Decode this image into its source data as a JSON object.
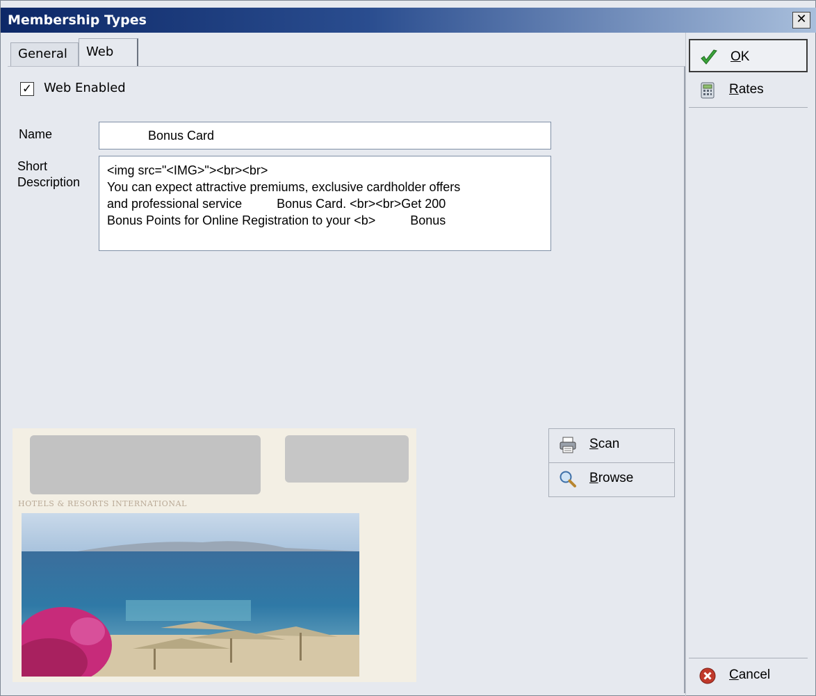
{
  "window": {
    "title": "Membership Types",
    "close_glyph": "✕"
  },
  "tabs": [
    {
      "label": "General",
      "active": false
    },
    {
      "label": "Web",
      "active": true
    }
  ],
  "web": {
    "web_enabled_label": "Web Enabled",
    "web_enabled_checked": true,
    "check_glyph": "✓",
    "name_label": "Name",
    "name_value": "Bonus Card",
    "short_description_label": "Short Description",
    "short_description_value": "<img src=\"<IMG>\"><br><br>\nYou can expect attractive premiums, exclusive cardholder offers\nand professional service          Bonus Card. <br><br>Get 200\nBonus Points for Online Registration to your <b>          Bonus"
  },
  "image": {
    "caption": "HOTELS & RESORTS INTERNATIONAL"
  },
  "actions": {
    "scan_label": "Scan",
    "browse_label": "Browse"
  },
  "sidebar": {
    "ok_label": "OK",
    "rates_label": "Rates",
    "cancel_label": "Cancel"
  },
  "icons": {
    "ok": "checkmark-icon",
    "rates": "calculator-icon",
    "cancel": "cancel-icon",
    "scan": "printer-icon",
    "browse": "magnifier-icon"
  },
  "colors": {
    "title_bar_start": "#0d2867",
    "title_bar_end": "#a9bfdc",
    "window_background": "#e6e9ef",
    "ok_green": "#3aa33a",
    "cancel_red": "#c0392b"
  }
}
